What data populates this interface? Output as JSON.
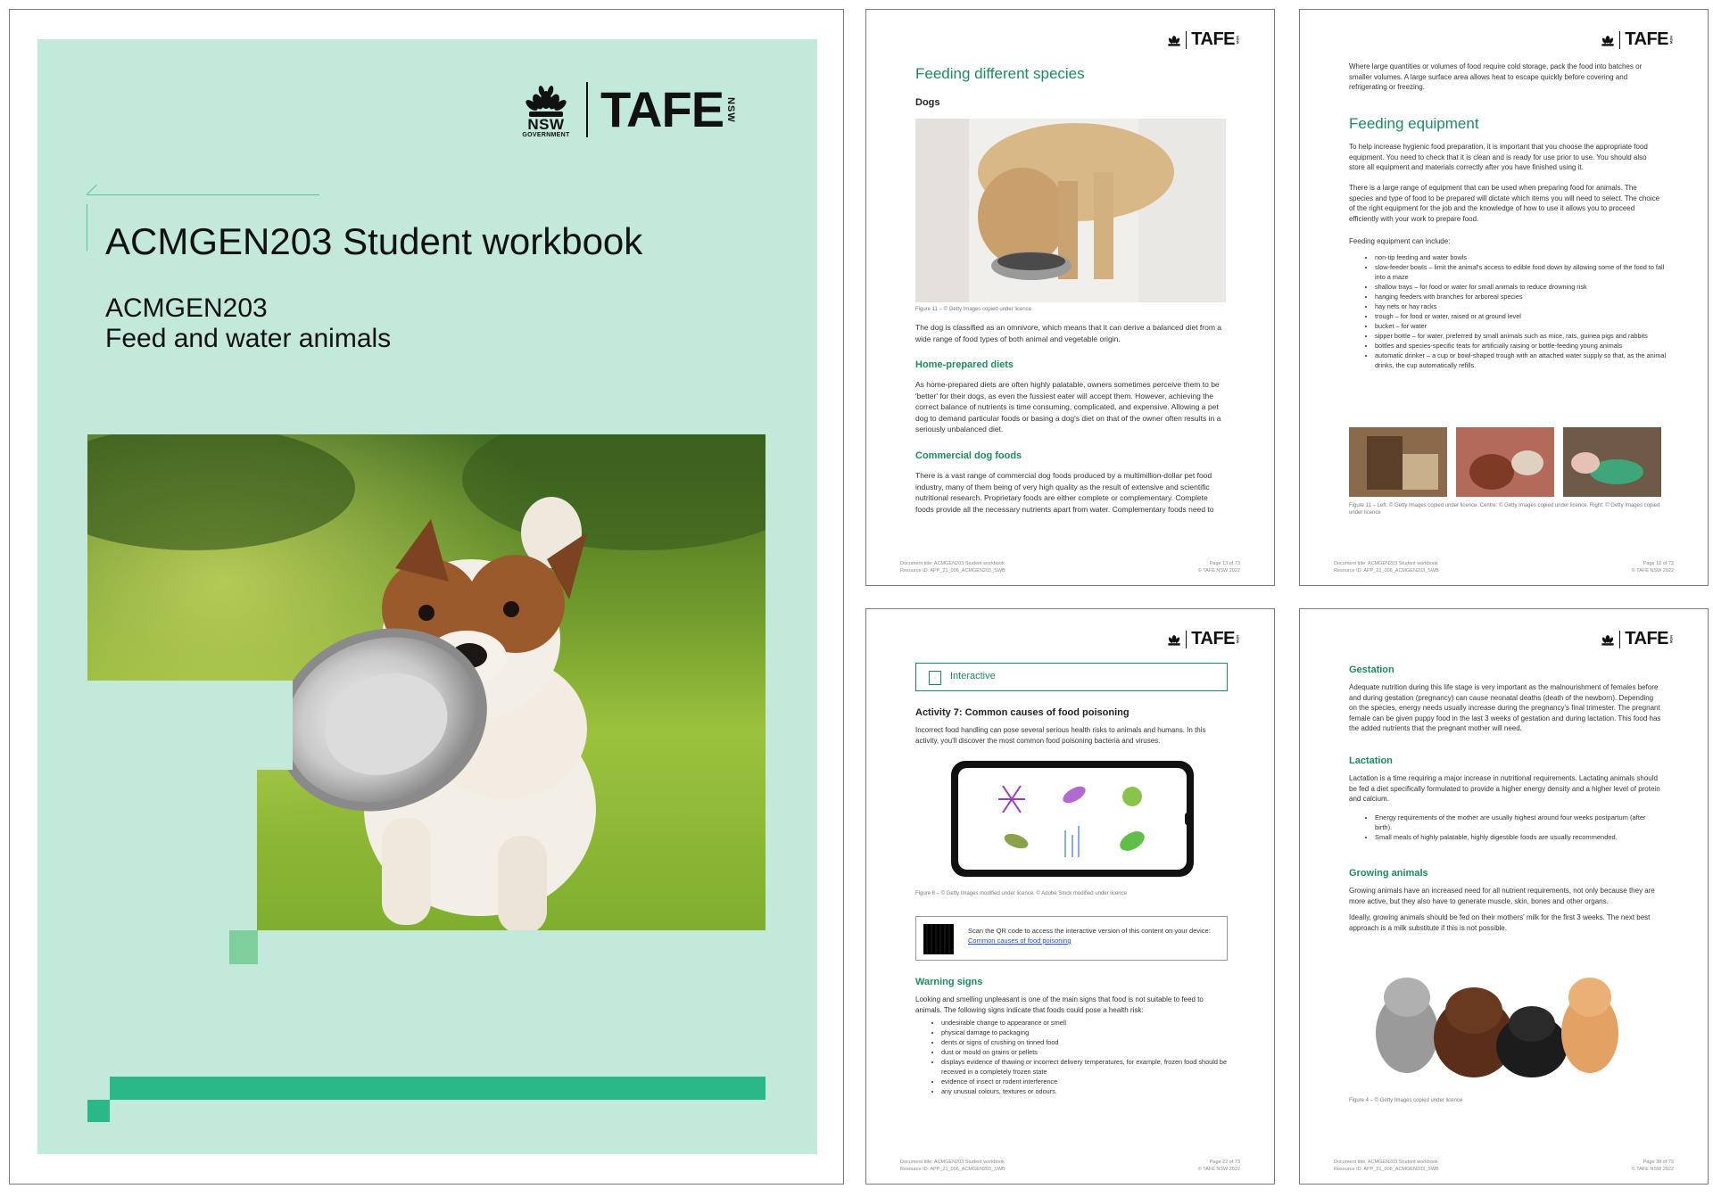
{
  "cover": {
    "title": "ACMGEN203 Student workbook",
    "subtitle_code": "ACMGEN203",
    "subtitle_name": "Feed and water animals",
    "logo_nsw": "NSW",
    "logo_gov": "GOVERNMENT",
    "logo_tafe": "TAFE",
    "logo_tafe_nsw": "NSW"
  },
  "page1": {
    "heading": "Feeding different species",
    "subheading": "Dogs",
    "caption": "Figure 11 – © Getty Images copied under licence",
    "intro": "The dog is classified as an omnivore, which means that it can derive a balanced diet from a wide range of food types of both animal and vegetable origin.",
    "h_home": "Home-prepared diets",
    "home_text": "As home-prepared diets are often highly palatable, owners sometimes perceive them to be 'better' for their dogs, as even the fussiest eater will accept them. However, achieving the correct balance of nutrients is time consuming, complicated, and expensive. Allowing a pet dog to demand particular foods or basing a dog's diet on that of the owner often results in a seriously unbalanced diet.",
    "h_commercial": "Commercial dog foods",
    "commercial_text": "There is a vast range of commercial dog foods produced by a multimillion-dollar pet food industry, many of them being of very high quality as the result of extensive and scientific nutritional research. Proprietary foods are either complete or complementary. Complete foods provide all the necessary nutrients apart from water. Complementary foods need to",
    "footer_left": "Document title: ACMGEN203 Student workbook\nResource ID: APP_21_006_ACMGEN203_SWB",
    "footer_right": "Page 13 of 73\n© TAFE NSW 2022"
  },
  "page2": {
    "top_text": "Where large quantities or volumes of food require cold storage, pack the food into batches or smaller volumes. A large surface area allows heat to escape quickly before covering and refrigerating or freezing.",
    "heading": "Feeding equipment",
    "p1": "To help increase hygienic food preparation, it is important that you choose the appropriate food equipment. You need to check that it is clean and is ready for use prior to use. You should also store all equipment and materials correctly after you have finished using it.",
    "p2": "There is a large range of equipment that can be used when preparing food for animals. The species and type of food to be prepared will dictate which items you will need to select. The choice of the right equipment for the job and the knowledge of how to use it allows you to proceed efficiently with your work to prepare food.",
    "list_intro": "Feeding equipment can include:",
    "items": [
      "non-tip feeding and water bowls",
      "slow-feeder bowls – limit the animal's access to edible food down by allowing some of the food to fall into a maze",
      "shallow trays – for food or water for small animals to reduce drowning risk",
      "hanging feeders with branches for arboreal species",
      "hay nets or hay racks",
      "trough – for food or water, raised or at ground level",
      "bucket – for water",
      "sipper bottle – for water, preferred by small animals such as mice, rats, guinea pigs and rabbits",
      "bottles and species-specific teats for artificially raising or bottle-feeding young animals",
      "automatic drinker – a cup or bowl-shaped trough with an attached water supply so that, as the animal drinks, the cup automatically refills."
    ],
    "caption": "Figure 11 – Left: © Getty Images copied under licence. Centre: © Getty Images copied under licence. Right: © Getty Images copied under licence",
    "footer_left": "Document title: ACMGEN203 Student workbook\nResource ID: APP_21_006_ACMGEN203_SWB",
    "footer_right": "Page 16 of 73\n© TAFE NSW 2022"
  },
  "page3": {
    "interactive_label": "Interactive",
    "activity_title": "Activity 7: Common causes of food poisoning",
    "activity_text": "Incorrect food handling can pose several serious health risks to animals and humans. In this activity, you'll discover the most common food poisoning bacteria and viruses.",
    "caption": "Figure 8 – © Getty Images modified under licence. © Adobe Stock modified under licence",
    "qr_text": "Scan the QR code to access the interactive version of this content on your device:",
    "qr_link": "Common causes of food poisoning",
    "h_warning": "Warning signs",
    "warning_text": "Looking and smelling unpleasant is one of the main signs that food is not suitable to feed to animals. The following signs indicate that foods could pose a health risk:",
    "items": [
      "undesirable change to appearance or smell",
      "physical damage to packaging",
      "dents or signs of crushing on tinned food",
      "dust or mould on grains or pellets",
      "displays evidence of thawing or incorrect delivery temperatures, for example, frozen food should be received in a completely frozen state",
      "evidence of insect or rodent interference",
      "any unusual colours, textures or odours."
    ],
    "footer_left": "Document title: ACMGEN203 Student workbook\nResource ID: APP_21_006_ACMGEN203_SWB",
    "footer_right": "Page 22 of 73\n© TAFE NSW 2022"
  },
  "page4": {
    "h_gestation": "Gestation",
    "gestation_text": "Adequate nutrition during this life stage is very important as the malnourishment of females before and during gestation (pregnancy) can cause neonatal deaths (death of the newborn). Depending on the species, energy needs usually increase during the pregnancy's final trimester. The pregnant female can be given puppy food in the last 3 weeks of gestation and during lactation. This food has the added nutrients that the pregnant mother will need.",
    "h_lactation": "Lactation",
    "lactation_text": "Lactation is a time requiring a major increase in nutritional requirements. Lactating animals should be fed a diet specifically formulated to provide a higher energy density and a higher level of protein and calcium.",
    "items": [
      "Energy requirements of the mother are usually highest around four weeks postpartum (after birth).",
      "Small meals of highly palatable, highly digestible foods are usually recommended."
    ],
    "h_growing": "Growing animals",
    "growing_text1": "Growing animals have an increased need for all nutrient requirements, not only because they are more active, but they also have to generate muscle, skin, bones and other organs.",
    "growing_text2": "Ideally, growing animals should be fed on their mothers' milk for the first 3 weeks. The next best approach is a milk substitute if this is not possible.",
    "caption": "Figure 4 – © Getty Images copied under licence",
    "footer_left": "Document title: ACMGEN203 Student workbook\nResource ID: APP_21_006_ACMGEN203_SWB",
    "footer_right": "Page 38 of 73\n© TAFE NSW 2022"
  }
}
